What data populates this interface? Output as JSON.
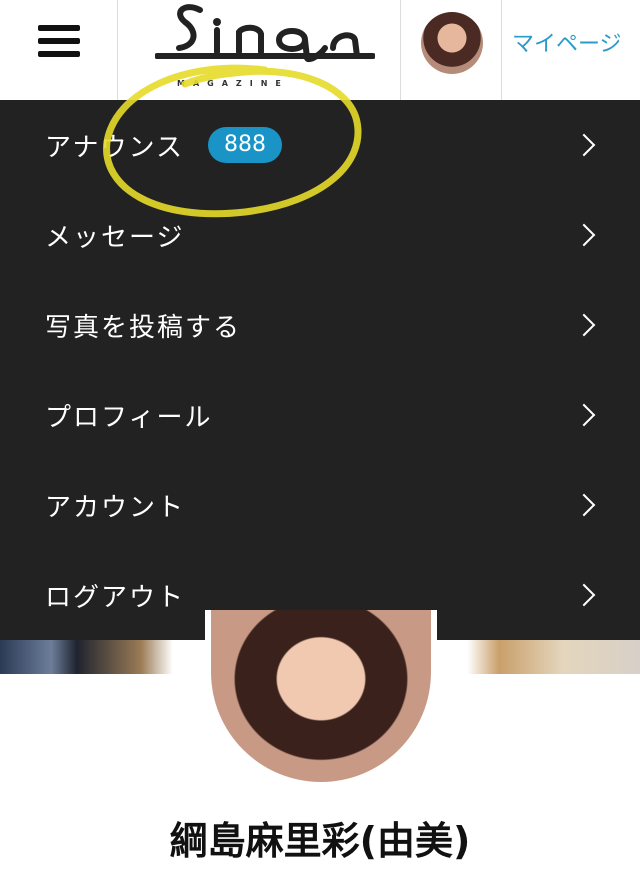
{
  "header": {
    "logo_text": "Sinq",
    "logo_subtitle": "MAGAZINE",
    "mypage_label": "マイページ"
  },
  "menu": {
    "items": [
      {
        "label": "アナウンス",
        "badge": "888"
      },
      {
        "label": "メッセージ"
      },
      {
        "label": "写真を投稿する"
      },
      {
        "label": "プロフィール"
      },
      {
        "label": "アカウント"
      },
      {
        "label": "ログアウト"
      }
    ]
  },
  "profile": {
    "name": "綱島麻里彩(由美)"
  },
  "colors": {
    "menu_bg": "#222222",
    "badge_bg": "#1a94c6",
    "link_blue": "#2a9bc9",
    "highlight_yellow": "#e6dc2a"
  }
}
